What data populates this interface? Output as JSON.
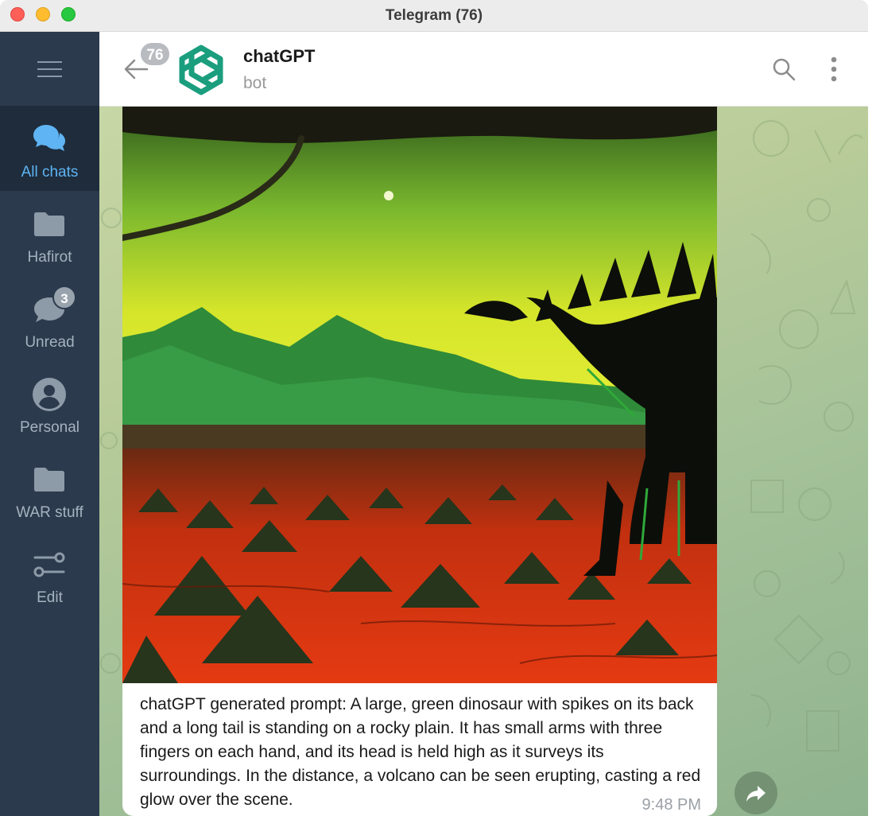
{
  "window": {
    "title": "Telegram (76)"
  },
  "sidebar": {
    "menu_icon": "hamburger-icon",
    "folders": [
      {
        "label": "All chats",
        "icon": "chats-icon",
        "active": true
      },
      {
        "label": "Hafirot",
        "icon": "folder-icon"
      },
      {
        "label": "Unread",
        "icon": "chat-bubble-icon",
        "badge": "3"
      },
      {
        "label": "Personal",
        "icon": "person-icon"
      },
      {
        "label": "WAR stuff",
        "icon": "folder-icon"
      },
      {
        "label": "Edit",
        "icon": "sliders-icon"
      }
    ]
  },
  "header": {
    "unread_count": "76",
    "chat_name": "chatGPT",
    "chat_status": "bot",
    "icons": [
      "back-arrow-icon",
      "openai-logo-icon",
      "search-icon",
      "more-vertical-icon"
    ]
  },
  "message": {
    "caption": "chatGPT generated prompt:  A large, green dinosaur with spikes on its back and a long tail is standing on a rocky plain. It has small arms with three fingers on each hand, and its head is held high as it surveys its surroundings. In the distance, a volcano can be seen erupting, casting a red glow over the scene.",
    "time": "9:48 PM",
    "forward_icon": "share-arrow-icon"
  },
  "colors": {
    "sidebar_bg": "#2b3a4d",
    "sidebar_active_bg": "#1e2c3c",
    "accent": "#5fb4f3",
    "openai_logo": "#1a9e7e"
  }
}
